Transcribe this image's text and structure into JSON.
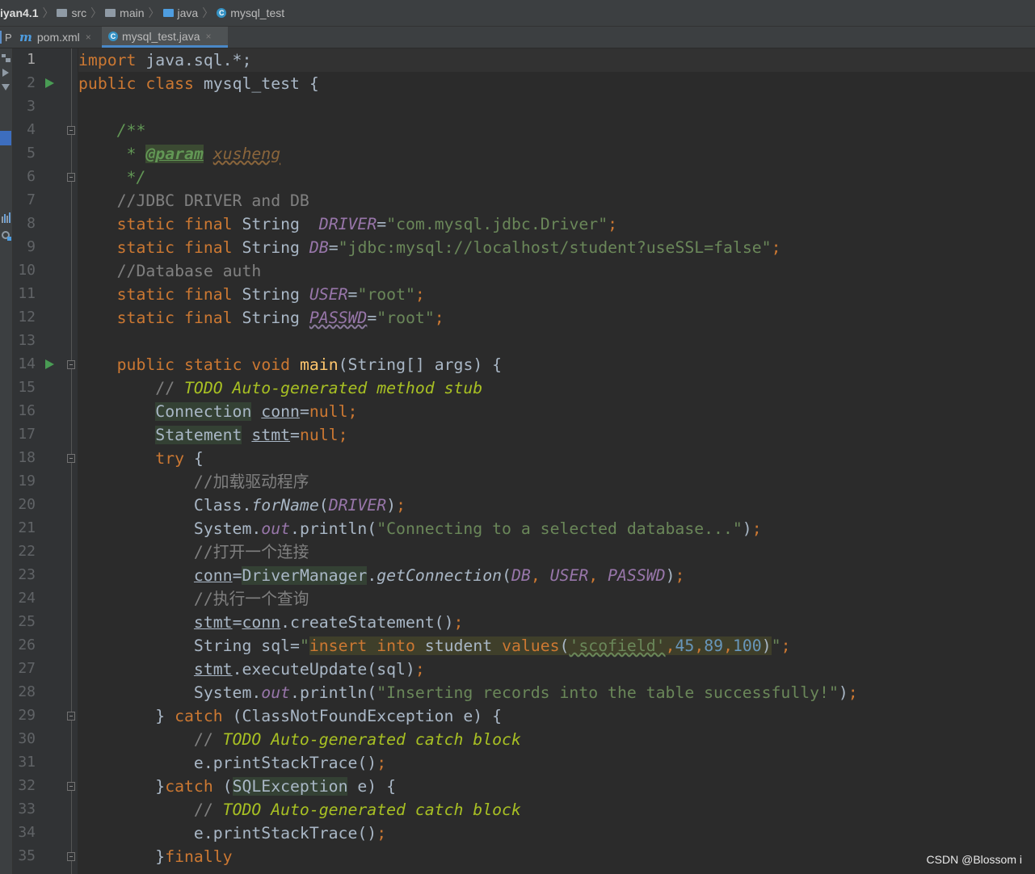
{
  "breadcrumb": {
    "project": "iyan4.1",
    "items": [
      "src",
      "main",
      "java",
      "mysql_test"
    ]
  },
  "tabs": {
    "project_stub": "P",
    "items": [
      {
        "icon": "m",
        "label": "pom.xml",
        "close": "×"
      },
      {
        "icon": "C",
        "label": "mysql_test.java",
        "close": "×"
      }
    ]
  },
  "editor": {
    "line_numbers": [
      "1",
      "2",
      "3",
      "4",
      "5",
      "6",
      "7",
      "8",
      "9",
      "10",
      "11",
      "12",
      "13",
      "14",
      "15",
      "16",
      "17",
      "18",
      "19",
      "20",
      "21",
      "22",
      "23",
      "24",
      "25",
      "26",
      "27",
      "28",
      "29",
      "30",
      "31",
      "32",
      "33",
      "34",
      "35"
    ],
    "tokens": {
      "import": "import",
      "java_sql_star": " java.sql.*;",
      "public": "public",
      "class": "class",
      "class_name": " mysql_test {",
      "doc_open": "/**",
      "doc_star": " * ",
      "doc_param": "@param",
      "doc_param_val": "xusheng",
      "doc_close": " */",
      "c_jdbc": "//JDBC DRIVER and DB",
      "static": "static",
      "final": "final",
      "String": "String",
      "DRIVER": "DRIVER",
      "driver_val": "\"com.mysql.jdbc.Driver\"",
      "DB": "DB",
      "db_val": "\"jdbc:mysql://localhost/student?useSSL=false\"",
      "c_auth": "//Database auth",
      "USER": "USER",
      "user_val": "\"root\"",
      "PASSWD": "PASSWD",
      "passwd_val": "\"root\"",
      "static_kw": "static",
      "void": "void",
      "main": "main",
      "main_args": "(String[] args) {",
      "todo_slash": "// ",
      "todo_stub": "TODO Auto-generated method stub",
      "Connection": "Connection",
      "conn": "conn",
      "null": "null",
      "Statement": "Statement",
      "stmt": "stmt",
      "try": "try",
      "c_load": "//加载驱动程序",
      "Class": "Class.",
      "forName": "forName",
      "System": "System.",
      "out": "out",
      "println": ".println(",
      "msg_connect": "\"Connecting to a selected database...\"",
      "c_open": "//打开一个连接",
      "DriverManager": "DriverManager",
      "getConnection": "getConnection",
      "c_exec": "//执行一个查询",
      "createStatement": ".createStatement()",
      "sql_decl": "String sql=",
      "sql_insert": "insert",
      "sql_into": "into",
      "sql_student": " student ",
      "sql_values": "values",
      "sql_scofield": "'scofield'",
      "sql_n1": "45",
      "sql_n2": "89",
      "sql_n3": "100",
      "executeUpdate": ".executeUpdate(sql)",
      "msg_insert": "\"Inserting records into the table successfully!\"",
      "catch": "catch",
      "cnfe": " (ClassNotFoundException e) {",
      "todo_catch": "TODO Auto-generated catch block",
      "printStackTrace": "e.printStackTrace()",
      "SQLException": "SQLException",
      "finally": "finally"
    }
  },
  "watermark": "CSDN @Blossom i"
}
